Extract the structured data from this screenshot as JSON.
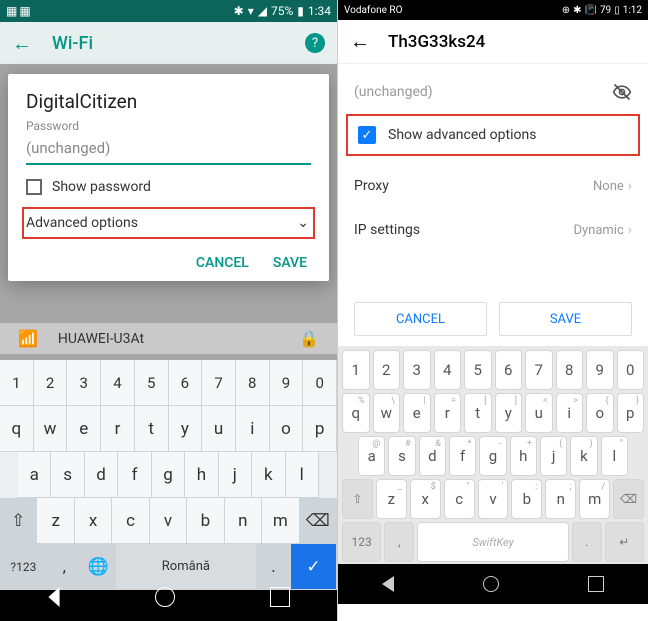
{
  "left": {
    "status": {
      "battery": "75%",
      "time": "1:34"
    },
    "appbar": {
      "title": "Wi-Fi"
    },
    "dialog": {
      "ssid": "DigitalCitizen",
      "password_label": "Password",
      "password_value": "(unchanged)",
      "show_password": "Show password",
      "advanced": "Advanced options",
      "cancel": "CANCEL",
      "save": "SAVE"
    },
    "bg_network": "HUAWEI-U3At",
    "keyboard": {
      "nums": [
        "1",
        "2",
        "3",
        "4",
        "5",
        "6",
        "7",
        "8",
        "9",
        "0"
      ],
      "row1": [
        "q",
        "w",
        "e",
        "r",
        "t",
        "y",
        "u",
        "i",
        "o",
        "p"
      ],
      "row2": [
        "a",
        "s",
        "d",
        "f",
        "g",
        "h",
        "j",
        "k",
        "l"
      ],
      "row3": [
        "z",
        "x",
        "c",
        "v",
        "b",
        "n",
        "m"
      ],
      "sym": "?123",
      "lang": "Română"
    }
  },
  "right": {
    "status": {
      "carrier": "Vodafone RO",
      "battery": "79",
      "time": "1:12"
    },
    "appbar": {
      "title": "Th3G33ks24"
    },
    "password_placeholder": "(unchanged)",
    "show_advanced": "Show advanced options",
    "rows": {
      "proxy": {
        "name": "Proxy",
        "value": "None"
      },
      "ip": {
        "name": "IP settings",
        "value": "Dynamic"
      }
    },
    "buttons": {
      "cancel": "CANCEL",
      "save": "SAVE"
    },
    "keyboard": {
      "nums": [
        "1",
        "2",
        "3",
        "4",
        "5",
        "6",
        "7",
        "8",
        "9",
        "0"
      ],
      "row1": [
        "q",
        "w",
        "e",
        "r",
        "t",
        "y",
        "u",
        "i",
        "o",
        "p"
      ],
      "row2": [
        "a",
        "s",
        "d",
        "f",
        "g",
        "h",
        "j",
        "k",
        "l"
      ],
      "row3": [
        "z",
        "x",
        "c",
        "v",
        "b",
        "n",
        "m"
      ],
      "swiftkey": "SwiftKey"
    }
  }
}
